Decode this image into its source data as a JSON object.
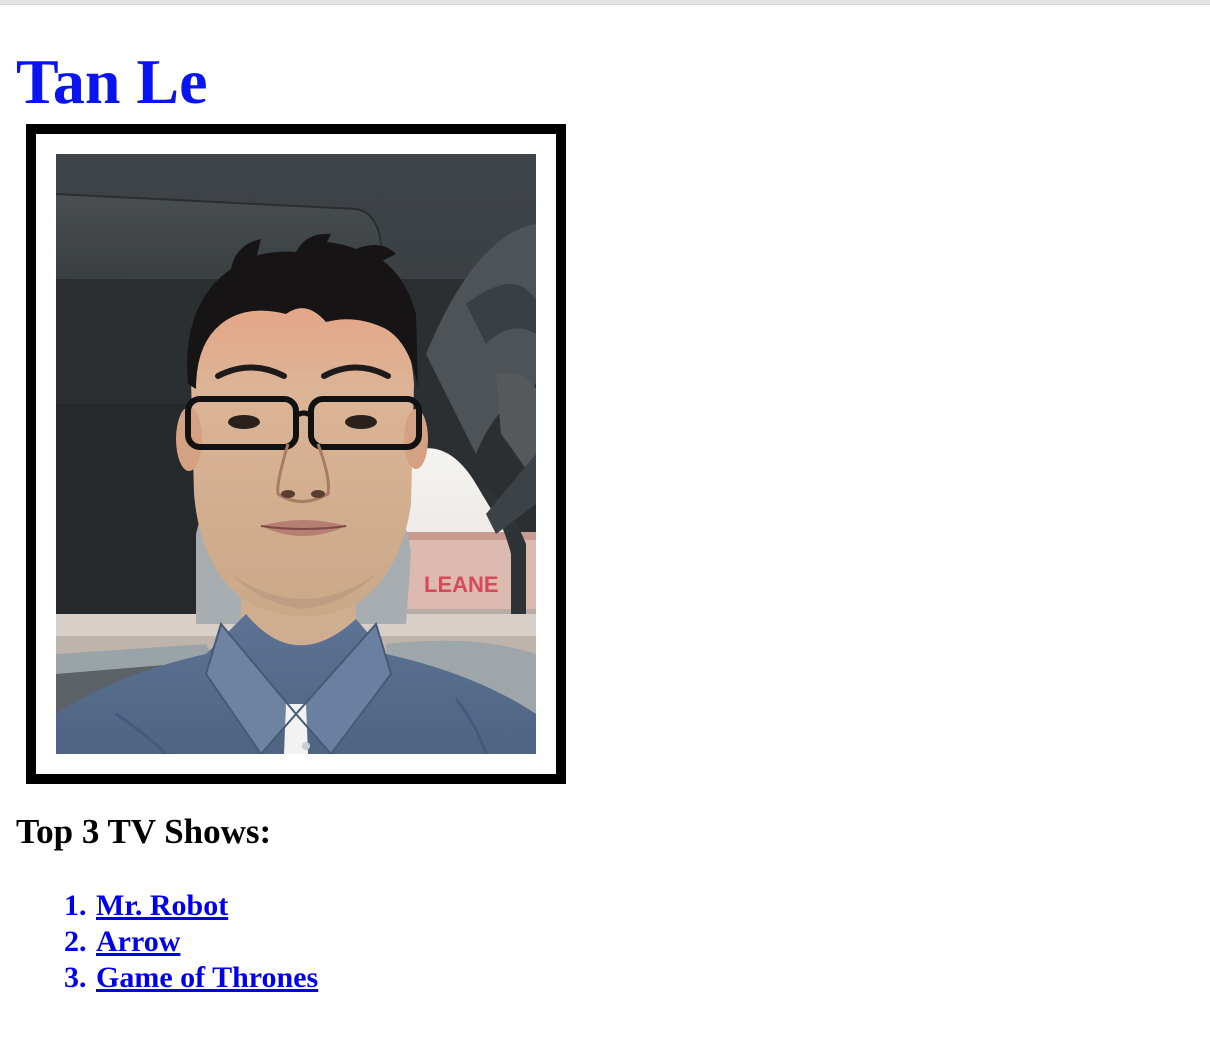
{
  "colors": {
    "link": "#0000ee",
    "title": "#0a14f0",
    "text": "#000000",
    "frame": "#000000"
  },
  "profile": {
    "name": "Tan Le"
  },
  "shows_section": {
    "heading": "Top 3 TV Shows:",
    "items": [
      {
        "number": "1.",
        "label": "Mr. Robot"
      },
      {
        "number": "2.",
        "label": "Arrow"
      },
      {
        "number": "3.",
        "label": "Game of Thrones"
      }
    ]
  },
  "photo": {
    "sign_text": "LEANE"
  }
}
